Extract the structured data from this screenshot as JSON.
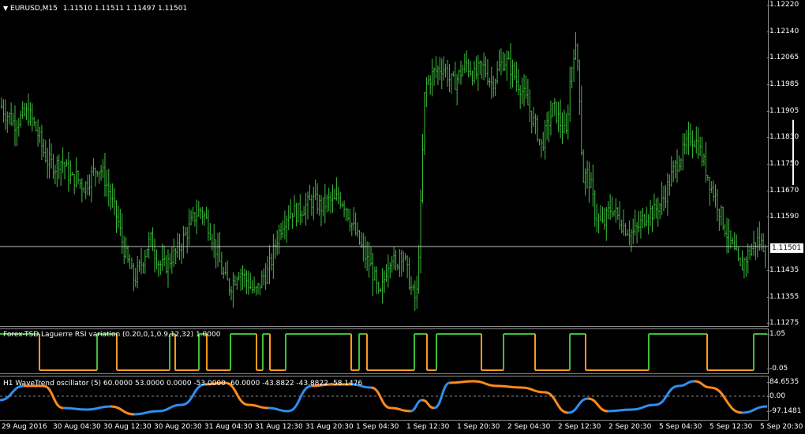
{
  "symbol_header": {
    "menu_icon": "triangle-down-icon",
    "title": "EURUSD,M15",
    "quotes": "1.11510 1.11511 1.11497 1.11501"
  },
  "price_axis": {
    "labels": [
      "1.12220",
      "1.12140",
      "1.12065",
      "1.11985",
      "1.11905",
      "1.11830",
      "1.11750",
      "1.11670",
      "1.11590",
      "1.11435",
      "1.11355",
      "1.11275"
    ],
    "current_price": "1.11501"
  },
  "rsi_pane": {
    "label": "Forex-TSD Laguerre RSI variation (0.20,0,1,0.9,12,32) 1.0000",
    "axis_top": "1.05",
    "axis_bottom": "-0.05",
    "level_high": 1.0,
    "level_low": 0.0
  },
  "wt_pane": {
    "label": "H1 WaveTrend oscillator (5) 60.0000 53.0000 0.0000 -53.0000 -60.0000 -43.8822 -43.8822 -58.1476",
    "axis_top": "84.6535",
    "axis_zero": "0.00",
    "axis_bottom": "-97.1481"
  },
  "time_axis": {
    "labels": [
      "29 Aug 2016",
      "30 Aug 04:30",
      "30 Aug 12:30",
      "30 Aug 20:30",
      "31 Aug 04:30",
      "31 Aug 12:30",
      "31 Aug 20:30",
      "1 Sep 04:30",
      "1 Sep 12:30",
      "1 Sep 20:30",
      "2 Sep 04:30",
      "2 Sep 12:30",
      "2 Sep 20:30",
      "5 Sep 04:30",
      "5 Sep 12:30",
      "5 Sep 20:30"
    ]
  },
  "colors": {
    "background": "#000000",
    "bars": "#3cbf3c",
    "rsi_up": "#3cbf3c",
    "rsi_down": "#ff9a1f",
    "wt_up": "#2f8ff0",
    "wt_down": "#ff8a1a",
    "grid": "#8a8a8a"
  },
  "chart_data": {
    "type": "line",
    "series_price_closes": [
      1.1192,
      1.119,
      1.1189,
      1.1187,
      1.1188,
      1.1189,
      1.119,
      1.1189,
      1.1186,
      1.1183,
      1.1179,
      1.1176,
      1.1175,
      1.1174,
      1.1176,
      1.1175,
      1.1172,
      1.117,
      1.1171,
      1.1169,
      1.1168,
      1.117,
      1.1172,
      1.1174,
      1.1173,
      1.117,
      1.1166,
      1.1162,
      1.1158,
      1.1152,
      1.1147,
      1.1143,
      1.114,
      1.1143,
      1.1146,
      1.115,
      1.1152,
      1.1148,
      1.1145,
      1.1144,
      1.1145,
      1.1147,
      1.1148,
      1.115,
      1.1153,
      1.1155,
      1.1158,
      1.116,
      1.1161,
      1.1159,
      1.1156,
      1.1152,
      1.1148,
      1.1143,
      1.114,
      1.1138,
      1.114,
      1.1143,
      1.1142,
      1.114,
      1.1138,
      1.1136,
      1.1138,
      1.1141,
      1.1142,
      1.1146,
      1.1151,
      1.1155,
      1.1158,
      1.116,
      1.1161,
      1.116,
      1.1161,
      1.1162,
      1.1163,
      1.1164,
      1.1163,
      1.1162,
      1.1163,
      1.1164,
      1.1163,
      1.1165,
      1.1164,
      1.1162,
      1.1158,
      1.1155,
      1.1152,
      1.1149,
      1.1146,
      1.1144,
      1.114,
      1.1134,
      1.1139,
      1.1145,
      1.1148,
      1.1143,
      1.1149,
      1.1147,
      1.1141,
      1.1136,
      1.1134,
      1.1162,
      1.1198,
      1.12,
      1.1202,
      1.1203,
      1.1204,
      1.1203,
      1.12,
      1.1199,
      1.1201,
      1.1203,
      1.1205,
      1.1203,
      1.1201,
      1.1203,
      1.1204,
      1.1202,
      1.1199,
      1.1201,
      1.1204,
      1.1206,
      1.1205,
      1.1203,
      1.12,
      1.1198,
      1.1195,
      1.1192,
      1.1188,
      1.1185,
      1.118,
      1.1184,
      1.1188,
      1.1192,
      1.1189,
      1.1186,
      1.1183,
      1.12,
      1.121,
      1.1205,
      1.117,
      1.1172,
      1.1168,
      1.116,
      1.1158,
      1.1156,
      1.116,
      1.1162,
      1.116,
      1.1158,
      1.1156,
      1.1155,
      1.1154,
      1.1155,
      1.1157,
      1.1159,
      1.1161,
      1.116,
      1.1162,
      1.1163,
      1.1166,
      1.117,
      1.1173,
      1.1176,
      1.1178,
      1.118,
      1.1183,
      1.1182,
      1.118,
      1.1176,
      1.1172,
      1.1168,
      1.1165,
      1.1161,
      1.1157,
      1.1153,
      1.115,
      1.1147,
      1.1143,
      1.1146,
      1.1148,
      1.115,
      1.1152,
      1.1151,
      1.115
    ],
    "price_ylim": [
      1.1126,
      1.1224
    ]
  }
}
